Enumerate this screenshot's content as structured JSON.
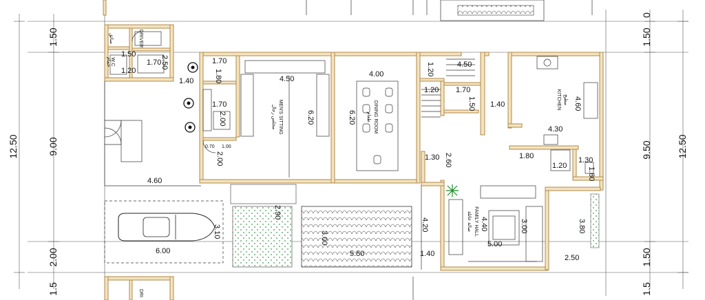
{
  "left_dims": {
    "top": "1.50",
    "middle": "9.00",
    "total": "12.50",
    "bottom": "2.00",
    "cut": "1.5"
  },
  "right_dims": {
    "top_small": "0",
    "top": "1.50",
    "middle": "9.50",
    "total": "12.50",
    "bottom": "1.50",
    "cut": "1.5"
  },
  "rooms": {
    "driver": "DRIVER",
    "driver_ar": "سائق",
    "wc": "W.C",
    "wc_ar": "حمام",
    "mens_sitting": "MEN'S SITTING",
    "mens_sitting_ar": "مجلس رجال",
    "dining": "DINING ROOM",
    "dining_ar": "طعام",
    "kitchen": "KITCHEN",
    "kitchen_ar": "مطبخ",
    "family": "FAMILY HALL",
    "family_ar": "صالة عائلة",
    "driver_bottom": "DRI"
  },
  "dims": {
    "d170a": "1.70",
    "d150a": "1.50",
    "d250a": "2.50",
    "d170b": "1.70",
    "d120a": "1.20",
    "d140a": "1.40",
    "d170c": "1.70",
    "d180a": "1.80",
    "d450a": "4.50",
    "d200a": "2.00",
    "d070": "0.70",
    "d100": "1.00",
    "d200b": "2.00",
    "d620a": "6.20",
    "d400a": "4.00",
    "d620b": "6.20",
    "d120b": "1.20",
    "d450b": "4.50",
    "d170d": "1.70",
    "d150b": "1.50",
    "d140b": "1.40",
    "d460a": "4.60",
    "d430": "4.30",
    "d180b": "1.80",
    "d120c": "1.20",
    "d130a": "1.30",
    "d180c": "1.80",
    "d130b": "1.30",
    "d260": "2.60",
    "d460b": "4.60",
    "d290": "2.90",
    "d310": "3.10",
    "d600": "6.00",
    "d300": "3.00",
    "d550": "5.50",
    "d420": "4.20",
    "d140c": "1.40",
    "d500": "5.00",
    "d380": "3.80",
    "d250b": "2.50",
    "d440": "4.40",
    "d300b": "3.00"
  }
}
